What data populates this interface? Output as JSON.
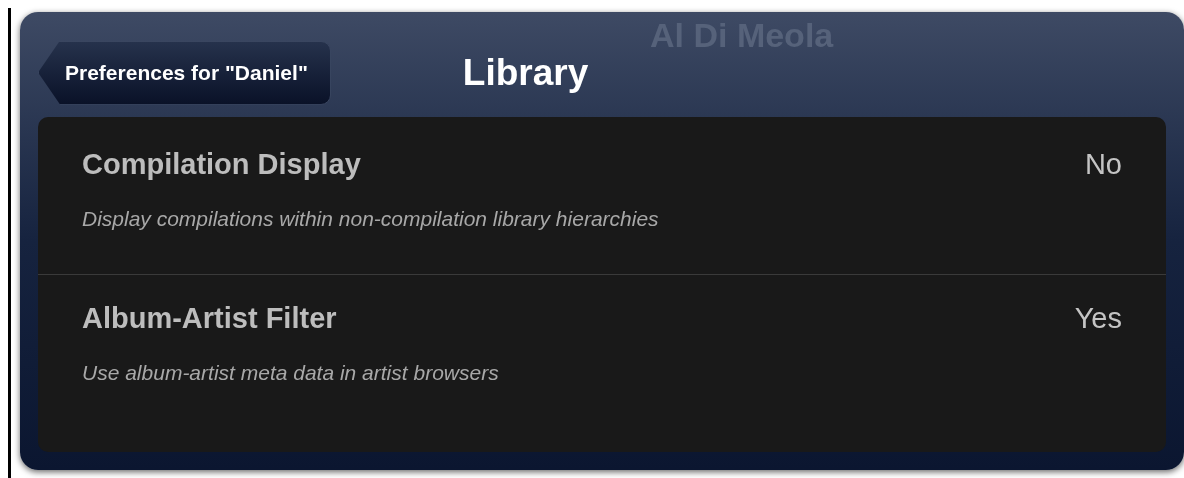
{
  "background": {
    "title": "Al Di Meola"
  },
  "nav": {
    "back_button": "Preferences for \"Daniel\"",
    "title": "Library"
  },
  "settings": [
    {
      "title": "Compilation Display",
      "value": "No",
      "description": "Display compilations within non-compilation library hierarchies"
    },
    {
      "title": "Album-Artist Filter",
      "value": "Yes",
      "description": "Use album-artist meta data in artist browsers"
    }
  ]
}
